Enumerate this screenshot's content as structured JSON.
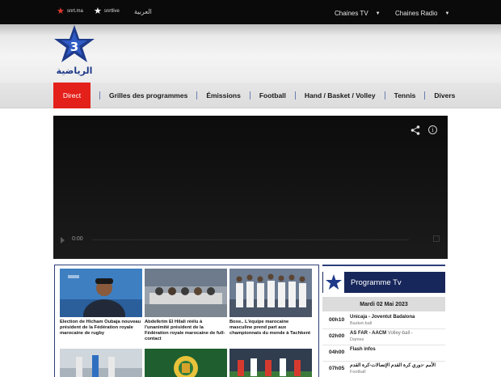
{
  "topbar": {
    "brand1": "snrt.ma",
    "brand2": "snrtlive",
    "language": "العربية",
    "nav": [
      {
        "label": "Chaines TV"
      },
      {
        "label": "Chaines Radio"
      }
    ]
  },
  "logo": {
    "channel_number": "3",
    "arabic_name": "الرياضية"
  },
  "menu": {
    "items": [
      {
        "label": "Direct",
        "active": true
      },
      {
        "label": "Grilles des programmes"
      },
      {
        "label": "Émissions"
      },
      {
        "label": "Football"
      },
      {
        "label": "Hand / Basket / Volley"
      },
      {
        "label": "Tennis"
      },
      {
        "label": "Divers"
      }
    ]
  },
  "player": {
    "time": "0:00",
    "info_glyph": "i"
  },
  "news": {
    "items": [
      {
        "caption": "Élection de Hicham Oubaja nouveau président de la Fédération royale marocaine de rugby"
      },
      {
        "caption": "Abdelkrim El Hilali réélu à l'unanimité président de la Fédération royale marocaine de full-contact"
      },
      {
        "caption": "Boxe.. L'équipe marocaine masculine prend part aux championnats du monde à Tachkent"
      }
    ]
  },
  "program": {
    "title": "Programme Tv",
    "date": "Mardi 02 Mai 2023",
    "rows": [
      {
        "time": "00h10",
        "title": "Unicaja - Joventut Badalona",
        "category": "Basket-ball"
      },
      {
        "time": "02h00",
        "title": "AS FAR - AACM",
        "inline_category": "Volley-ball -",
        "category": "Dames"
      },
      {
        "time": "04h00",
        "title": "Flash infos",
        "category": ""
      },
      {
        "time": "07h05",
        "title": "الأمم -دوري كرة القدم الإتصالات-كرة القدم",
        "category": "Football"
      }
    ]
  },
  "colors": {
    "accent_red": "#e4201a",
    "navy": "#17265b",
    "star_red": "#e23b2e"
  }
}
